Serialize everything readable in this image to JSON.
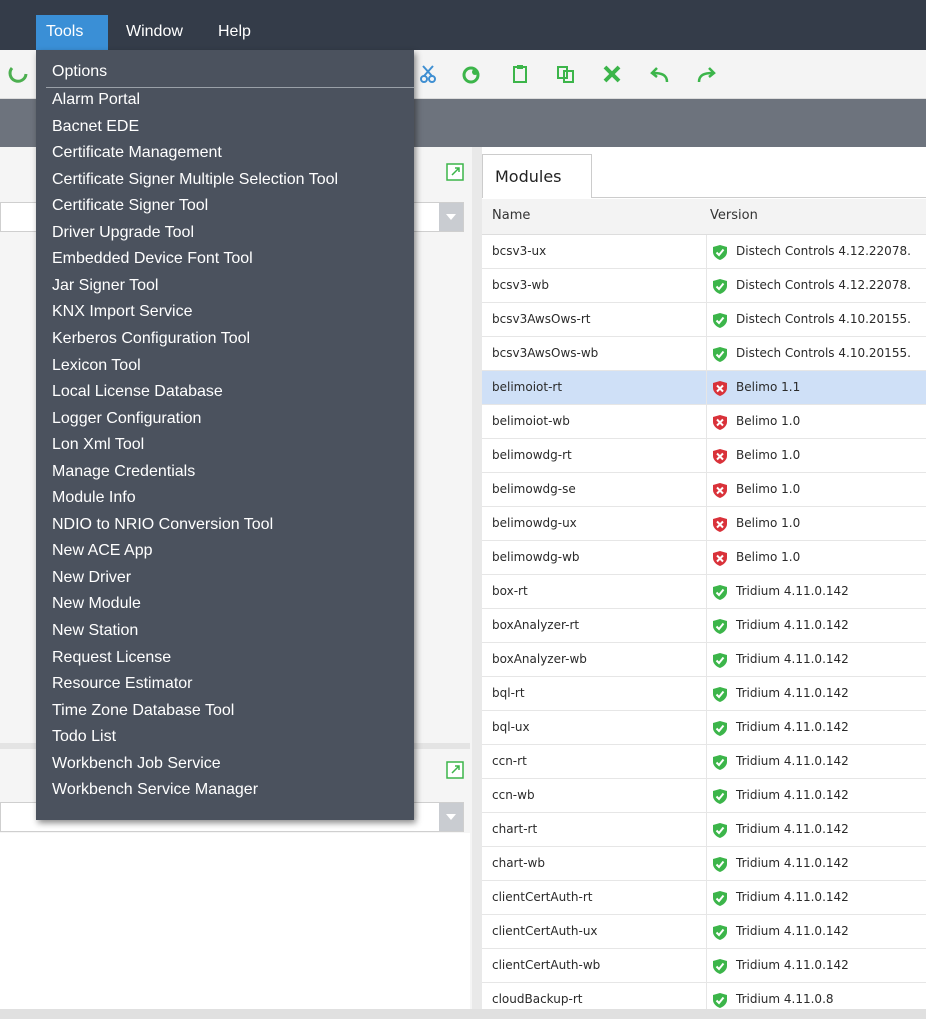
{
  "menubar": {
    "items": [
      {
        "label": "Tools",
        "active": true
      },
      {
        "label": "Window",
        "active": false
      },
      {
        "label": "Help",
        "active": false
      }
    ]
  },
  "toolbar": {
    "icons": [
      "refresh-icon",
      "cut-icon",
      "copy-icon",
      "paste-icon",
      "duplicate-icon",
      "delete-icon",
      "undo-icon",
      "redo-icon"
    ]
  },
  "tools_menu": {
    "items": [
      "Options",
      "Alarm Portal",
      "Bacnet EDE",
      "Certificate Management",
      "Certificate Signer Multiple Selection Tool",
      "Certificate Signer Tool",
      "Driver Upgrade Tool",
      "Embedded Device Font Tool",
      "Jar Signer Tool",
      "KNX Import Service",
      "Kerberos Configuration Tool",
      "Lexicon Tool",
      "Local License Database",
      "Logger Configuration",
      "Lon Xml Tool",
      "Manage Credentials",
      "Module Info",
      "NDIO to NRIO Conversion Tool",
      "New ACE App",
      "New Driver",
      "New Module",
      "New Station",
      "Request License",
      "Resource Estimator",
      "Time Zone Database Tool",
      "Todo List",
      "Workbench Job Service",
      "Workbench Service Manager"
    ]
  },
  "modules": {
    "tab_label": "Modules",
    "columns": [
      "Name",
      "Version"
    ],
    "rows": [
      {
        "name": "bcsv3-ux",
        "version": "Distech Controls 4.12.22078.",
        "status": "ok"
      },
      {
        "name": "bcsv3-wb",
        "version": "Distech Controls 4.12.22078.",
        "status": "ok"
      },
      {
        "name": "bcsv3AwsOws-rt",
        "version": "Distech Controls 4.10.20155.",
        "status": "ok"
      },
      {
        "name": "bcsv3AwsOws-wb",
        "version": "Distech Controls 4.10.20155.",
        "status": "ok"
      },
      {
        "name": "belimoiot-rt",
        "version": "Belimo 1.1",
        "status": "error",
        "selected": true
      },
      {
        "name": "belimoiot-wb",
        "version": "Belimo 1.0",
        "status": "error"
      },
      {
        "name": "belimowdg-rt",
        "version": "Belimo 1.0",
        "status": "error"
      },
      {
        "name": "belimowdg-se",
        "version": "Belimo 1.0",
        "status": "error"
      },
      {
        "name": "belimowdg-ux",
        "version": "Belimo 1.0",
        "status": "error"
      },
      {
        "name": "belimowdg-wb",
        "version": "Belimo 1.0",
        "status": "error"
      },
      {
        "name": "box-rt",
        "version": "Tridium 4.11.0.142",
        "status": "ok"
      },
      {
        "name": "boxAnalyzer-rt",
        "version": "Tridium 4.11.0.142",
        "status": "ok"
      },
      {
        "name": "boxAnalyzer-wb",
        "version": "Tridium 4.11.0.142",
        "status": "ok"
      },
      {
        "name": "bql-rt",
        "version": "Tridium 4.11.0.142",
        "status": "ok"
      },
      {
        "name": "bql-ux",
        "version": "Tridium 4.11.0.142",
        "status": "ok"
      },
      {
        "name": "ccn-rt",
        "version": "Tridium 4.11.0.142",
        "status": "ok"
      },
      {
        "name": "ccn-wb",
        "version": "Tridium 4.11.0.142",
        "status": "ok"
      },
      {
        "name": "chart-rt",
        "version": "Tridium 4.11.0.142",
        "status": "ok"
      },
      {
        "name": "chart-wb",
        "version": "Tridium 4.11.0.142",
        "status": "ok"
      },
      {
        "name": "clientCertAuth-rt",
        "version": "Tridium 4.11.0.142",
        "status": "ok"
      },
      {
        "name": "clientCertAuth-ux",
        "version": "Tridium 4.11.0.142",
        "status": "ok"
      },
      {
        "name": "clientCertAuth-wb",
        "version": "Tridium 4.11.0.142",
        "status": "ok"
      },
      {
        "name": "cloudBackup-rt",
        "version": "Tridium 4.11.0.8",
        "status": "ok"
      }
    ]
  },
  "colors": {
    "menubar": "#343c49",
    "menu_active": "#3a8fd6",
    "dropdown": "#4b525e",
    "ok_shield": "#3cb54a",
    "error_shield": "#d9323a",
    "selected_row": "#cfe0f7"
  }
}
